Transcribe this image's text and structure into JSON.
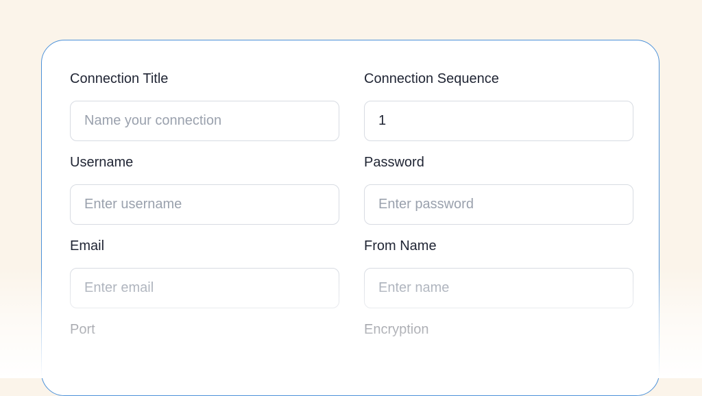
{
  "form": {
    "connection_title": {
      "label": "Connection Title",
      "value": "",
      "placeholder": "Name your connection"
    },
    "connection_sequence": {
      "label": "Connection Sequence",
      "value": "1",
      "placeholder": ""
    },
    "username": {
      "label": "Username",
      "value": "",
      "placeholder": "Enter username"
    },
    "password": {
      "label": "Password",
      "value": "",
      "placeholder": "Enter password"
    },
    "email": {
      "label": "Email",
      "value": "",
      "placeholder": "Enter email"
    },
    "from_name": {
      "label": "From Name",
      "value": "",
      "placeholder": "Enter name"
    },
    "port": {
      "label": "Port"
    },
    "encryption": {
      "label": "Encryption"
    }
  },
  "colors": {
    "page_background": "#fbf4ea",
    "card_border": "#4a90d9",
    "label_text": "#1f2433",
    "placeholder_text": "#9aa1ad",
    "input_border": "#d7dbe2"
  }
}
